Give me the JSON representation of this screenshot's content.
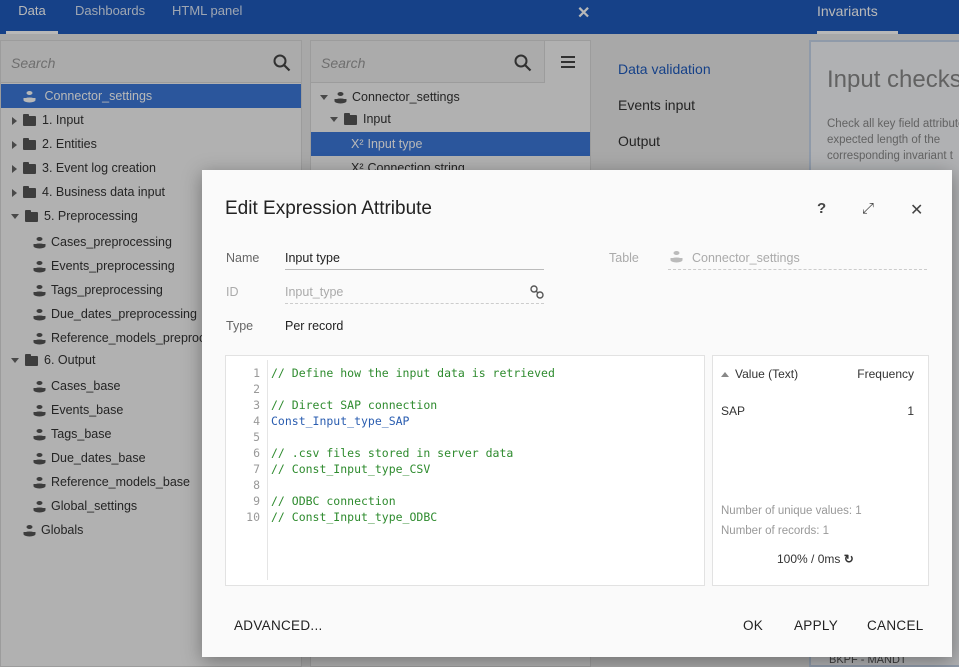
{
  "topbar": {
    "tabs": [
      {
        "label": "Data"
      },
      {
        "label": "Dashboards"
      },
      {
        "label": "HTML panel"
      }
    ],
    "close_glyph": "✕",
    "invariants_tab": "Invariants"
  },
  "left_tree": {
    "search_placeholder": "Search",
    "items": [
      {
        "label": "Connector_settings"
      },
      {
        "label": "1. Input"
      },
      {
        "label": "2. Entities"
      },
      {
        "label": "3. Event log creation"
      },
      {
        "label": "4. Business data input"
      },
      {
        "label": "5. Preprocessing"
      },
      {
        "label": "Cases_preprocessing"
      },
      {
        "label": "Events_preprocessing"
      },
      {
        "label": "Tags_preprocessing"
      },
      {
        "label": "Due_dates_preprocessing"
      },
      {
        "label": "Reference_models_preprocessing"
      },
      {
        "label": "6. Output"
      },
      {
        "label": "Cases_base"
      },
      {
        "label": "Events_base"
      },
      {
        "label": "Tags_base"
      },
      {
        "label": "Due_dates_base"
      },
      {
        "label": "Reference_models_base"
      },
      {
        "label": "Global_settings"
      },
      {
        "label": "Globals"
      }
    ]
  },
  "mid_tree": {
    "search_placeholder": "Search",
    "items": [
      {
        "label": "Connector_settings"
      },
      {
        "label": "Input"
      },
      {
        "label": "Input type",
        "prefix": "X²"
      },
      {
        "label": "Connection string",
        "prefix": "X²"
      }
    ]
  },
  "right_nav": {
    "items": [
      {
        "label": "Data validation"
      },
      {
        "label": "Events input"
      },
      {
        "label": "Output"
      }
    ]
  },
  "invariants": {
    "title": "Input checks",
    "description": "Check all key field attributes for expected length of the corresponding invariant t",
    "footer": "BKPF - MANDT"
  },
  "dialog": {
    "title": "Edit Expression Attribute",
    "help_glyph": "?",
    "expand_glyph": "⤢",
    "close_glyph": "✕",
    "name_label": "Name",
    "name_value": "Input type",
    "table_label": "Table",
    "table_value": "Connector_settings",
    "id_label": "ID",
    "id_value": "Input_type",
    "type_label": "Type",
    "type_value": "Per record",
    "code_lines": [
      {
        "n": "1",
        "text": "// Define how the input data is retrieved",
        "kind": "comment"
      },
      {
        "n": "2",
        "text": "",
        "kind": "comment"
      },
      {
        "n": "3",
        "text": "// Direct SAP connection",
        "kind": "comment"
      },
      {
        "n": "4",
        "text": "Const_Input_type_SAP",
        "kind": "ident"
      },
      {
        "n": "5",
        "text": "",
        "kind": "comment"
      },
      {
        "n": "6",
        "text": "// .csv files stored in server data",
        "kind": "comment"
      },
      {
        "n": "7",
        "text": "// Const_Input_type_CSV",
        "kind": "comment"
      },
      {
        "n": "8",
        "text": "",
        "kind": "comment"
      },
      {
        "n": "9",
        "text": "// ODBC connection",
        "kind": "comment"
      },
      {
        "n": "10",
        "text": "// Const_Input_type_ODBC",
        "kind": "comment"
      }
    ],
    "stats": {
      "value_header": "Value (Text)",
      "frequency_header": "Frequency",
      "rows": [
        {
          "value": "SAP",
          "frequency": "1"
        }
      ],
      "unique_values": "Number of unique values: 1",
      "records": "Number of records: 1",
      "perf": "100% / 0ms",
      "refresh_glyph": "↻"
    },
    "buttons": {
      "advanced": "ADVANCED...",
      "ok": "OK",
      "apply": "APPLY",
      "cancel": "CANCEL"
    }
  }
}
